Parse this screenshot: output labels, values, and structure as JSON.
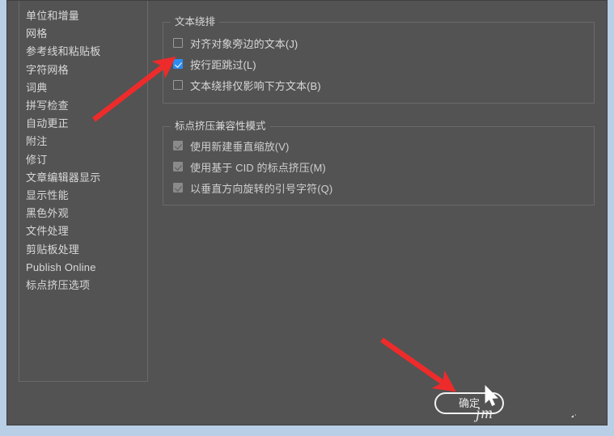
{
  "window": {
    "frame_color": "#b9cfe6",
    "body_color": "#535353",
    "border_color": "#6a6a6a",
    "text_color": "#d9d9d9",
    "accent_color": "#2d8cf0",
    "annotation_color": "#ee2b2b"
  },
  "sidebar": {
    "items": [
      {
        "label": "单位和增量"
      },
      {
        "label": "网格"
      },
      {
        "label": "参考线和粘贴板"
      },
      {
        "label": "字符网格"
      },
      {
        "label": "词典"
      },
      {
        "label": "拼写检查"
      },
      {
        "label": "自动更正"
      },
      {
        "label": "附注"
      },
      {
        "label": "修订"
      },
      {
        "label": "文章编辑器显示"
      },
      {
        "label": "显示性能"
      },
      {
        "label": "黑色外观"
      },
      {
        "label": "文件处理"
      },
      {
        "label": "剪贴板处理"
      },
      {
        "label": "Publish Online"
      },
      {
        "label": "标点挤压选项"
      }
    ]
  },
  "groups": [
    {
      "title": "文本绕排",
      "options": [
        {
          "label": "对齐对象旁边的文本(J)",
          "checked": false,
          "disabled": false
        },
        {
          "label": "按行距跳过(L)",
          "checked": true,
          "disabled": false
        },
        {
          "label": "文本绕排仅影响下方文本(B)",
          "checked": false,
          "disabled": false
        }
      ]
    },
    {
      "title": "标点挤压兼容性模式",
      "options": [
        {
          "label": "使用新建垂直缩放(V)",
          "checked": true,
          "disabled": true
        },
        {
          "label": "使用基于 CID 的标点挤压(M)",
          "checked": true,
          "disabled": true
        },
        {
          "label": "以垂直方向旋转的引号字符(Q)",
          "checked": true,
          "disabled": true
        }
      ]
    }
  ],
  "buttons": {
    "ok_label": "确定"
  },
  "overlay": {
    "watermark_text": "jm",
    "arrow_count": 2
  }
}
